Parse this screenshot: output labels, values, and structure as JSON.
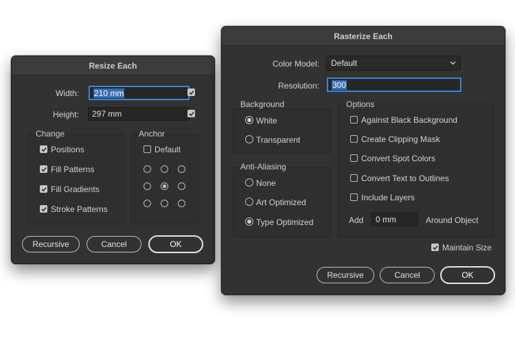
{
  "resize": {
    "title": "Resize Each",
    "width_label": "Width:",
    "width_value": "210 mm",
    "height_label": "Height:",
    "height_value": "297 mm",
    "change": {
      "title": "Change",
      "items": [
        {
          "label": "Positions",
          "checked": true
        },
        {
          "label": "Fill Patterns",
          "checked": true
        },
        {
          "label": "Fill Gradients",
          "checked": true
        },
        {
          "label": "Stroke Patterns",
          "checked": true
        }
      ]
    },
    "anchor": {
      "title": "Anchor",
      "default_label": "Default",
      "default_checked": false,
      "selected": "center"
    },
    "buttons": {
      "recursive": "Recursive",
      "cancel": "Cancel",
      "ok": "OK"
    }
  },
  "rasterize": {
    "title": "Rasterize Each",
    "color_model_label": "Color Model:",
    "color_model_value": "Default",
    "resolution_label": "Resolution:",
    "resolution_value": "300",
    "background": {
      "title": "Background",
      "options": [
        {
          "label": "White",
          "selected": true
        },
        {
          "label": "Transparent",
          "selected": false
        }
      ]
    },
    "anti_aliasing": {
      "title": "Anti-Aliasing",
      "options": [
        {
          "label": "None",
          "selected": false
        },
        {
          "label": "Art Optimized",
          "selected": false
        },
        {
          "label": "Type Optimized",
          "selected": true
        }
      ]
    },
    "options": {
      "title": "Options",
      "items": [
        {
          "label": "Against Black Background",
          "checked": false
        },
        {
          "label": "Create Clipping Mask",
          "checked": false
        },
        {
          "label": "Convert Spot Colors",
          "checked": false
        },
        {
          "label": "Convert Text to Outlines",
          "checked": false
        },
        {
          "label": "Include Layers",
          "checked": false
        }
      ],
      "add_label": "Add",
      "add_value": "0 mm",
      "around_label": "Around Object"
    },
    "maintain_size_label": "Maintain Size",
    "maintain_size_checked": true,
    "buttons": {
      "recursive": "Recursive",
      "cancel": "Cancel",
      "ok": "OK"
    }
  },
  "colors": {
    "dialog_bg": "#323232",
    "focus_ring": "#3b86d6",
    "text_selection": "#3b6fb0"
  }
}
